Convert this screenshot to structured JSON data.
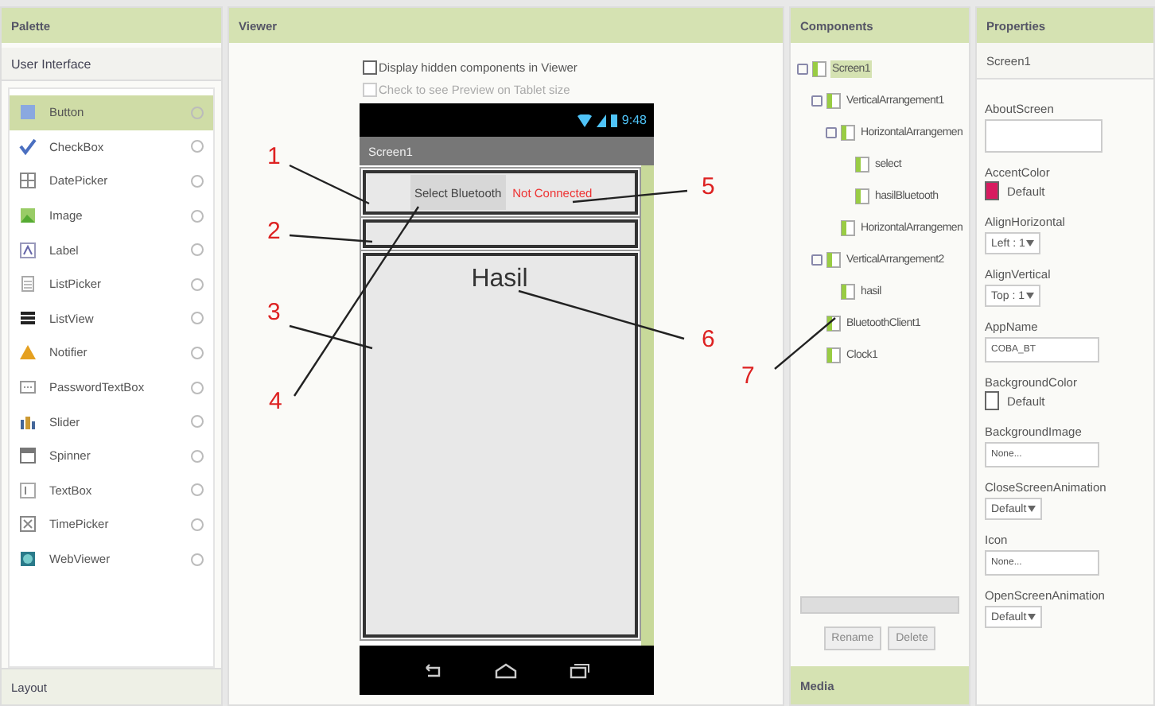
{
  "palette": {
    "title": "Palette",
    "section": "User Interface",
    "items": [
      {
        "label": "Button",
        "selected": true
      },
      {
        "label": "CheckBox",
        "selected": false
      },
      {
        "label": "DatePicker",
        "selected": false
      },
      {
        "label": "Image",
        "selected": false
      },
      {
        "label": "Label",
        "selected": false
      },
      {
        "label": "ListPicker",
        "selected": false
      },
      {
        "label": "ListView",
        "selected": false
      },
      {
        "label": "Notifier",
        "selected": false
      },
      {
        "label": "PasswordTextBox",
        "selected": false
      },
      {
        "label": "Slider",
        "selected": false
      },
      {
        "label": "Spinner",
        "selected": false
      },
      {
        "label": "TextBox",
        "selected": false
      },
      {
        "label": "TimePicker",
        "selected": false
      },
      {
        "label": "WebViewer",
        "selected": false
      }
    ],
    "footer": "Layout"
  },
  "viewer": {
    "title": "Viewer",
    "checkboxes": [
      {
        "label": "Display hidden components in Viewer",
        "checked": false,
        "disabled": false
      },
      {
        "label": "Check to see Preview on Tablet size",
        "checked": false,
        "disabled": true
      }
    ],
    "phone": {
      "time": "9:48",
      "screen_title": "Screen1",
      "button": "Select Bluetooth",
      "status": "Not Connected",
      "result": "Hasil"
    }
  },
  "annotations": [
    {
      "label": "1"
    },
    {
      "label": "2"
    },
    {
      "label": "3"
    },
    {
      "label": "4"
    },
    {
      "label": "5"
    },
    {
      "label": "6"
    },
    {
      "label": "7"
    }
  ],
  "components": {
    "title": "Components",
    "tree": [
      {
        "label": "Screen1",
        "selected": true,
        "children": [
          {
            "label": "VerticalArrangement1",
            "selected": false,
            "children": [
              {
                "label": "HorizontalArrangemen",
                "selected": false,
                "children": [
                  {
                    "label": "select",
                    "selected": false
                  },
                  {
                    "label": "hasilBluetooth",
                    "selected": false
                  }
                ]
              },
              {
                "label": "HorizontalArrangemen",
                "selected": false
              }
            ]
          },
          {
            "label": "VerticalArrangement2",
            "selected": false,
            "children": [
              {
                "label": "hasil",
                "selected": false
              }
            ]
          },
          {
            "label": "BluetoothClient1",
            "selected": false
          },
          {
            "label": "Clock1",
            "selected": false
          }
        ]
      }
    ],
    "buttons": [
      "Rename",
      "Delete"
    ],
    "footer": "Media"
  },
  "properties": {
    "title": "Properties",
    "subject": "Screen1",
    "items": [
      {
        "label": "AboutScreen",
        "kind": "textarea"
      },
      {
        "label": "AccentColor",
        "kind": "color",
        "value": "Default",
        "color": "#d81b60"
      },
      {
        "label": "AlignHorizontal",
        "kind": "select",
        "value": "Left : 1"
      },
      {
        "label": "AlignVertical",
        "kind": "select",
        "value": "Top : 1"
      },
      {
        "label": "AppName",
        "kind": "text",
        "value": "COBA_BT"
      },
      {
        "label": "BackgroundColor",
        "kind": "color",
        "value": "Default",
        "color": "#ffffff"
      },
      {
        "label": "BackgroundImage",
        "kind": "text",
        "value": "None..."
      },
      {
        "label": "CloseScreenAnimation",
        "kind": "select",
        "value": "Default"
      },
      {
        "label": "Icon",
        "kind": "text",
        "value": "None..."
      },
      {
        "label": "OpenScreenAnimation",
        "kind": "select",
        "value": "Default"
      }
    ]
  }
}
